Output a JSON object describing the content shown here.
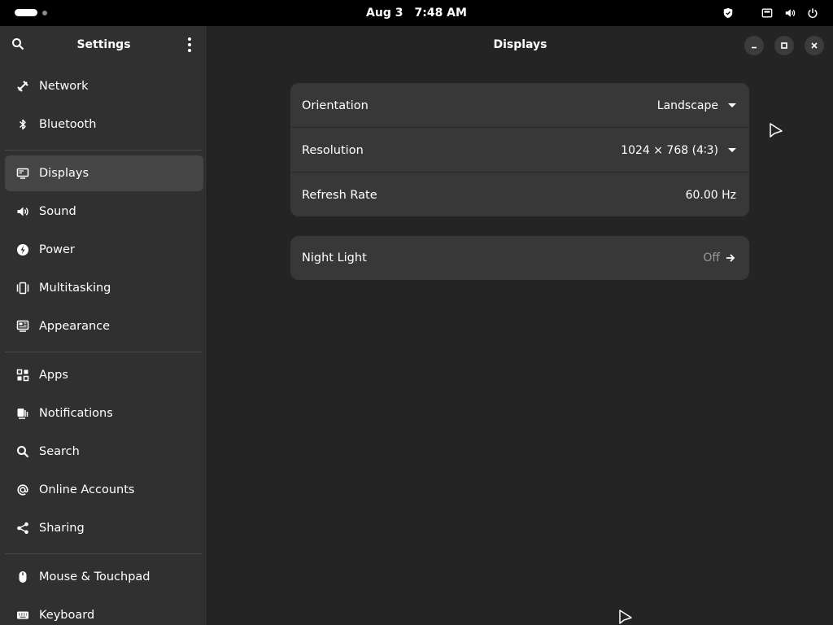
{
  "topbar": {
    "date": "Aug 3",
    "time": "7:48 AM",
    "tray_icons": [
      "shield-icon",
      "network-wired-icon",
      "volume-icon",
      "power-icon"
    ]
  },
  "sidebar": {
    "title": "Settings",
    "search_icon": "search-icon",
    "menu_icon": "kebab-menu-icon",
    "items": [
      {
        "label": "Network",
        "icon": "network-icon"
      },
      {
        "label": "Bluetooth",
        "icon": "bluetooth-icon"
      },
      {
        "label": "Displays",
        "icon": "display-icon",
        "active": true
      },
      {
        "label": "Sound",
        "icon": "speaker-icon"
      },
      {
        "label": "Power",
        "icon": "power-bolt-icon"
      },
      {
        "label": "Multitasking",
        "icon": "multitasking-icon"
      },
      {
        "label": "Appearance",
        "icon": "appearance-icon"
      },
      {
        "label": "Apps",
        "icon": "apps-grid-icon"
      },
      {
        "label": "Notifications",
        "icon": "notifications-icon"
      },
      {
        "label": "Search",
        "icon": "search-icon"
      },
      {
        "label": "Online Accounts",
        "icon": "at-icon"
      },
      {
        "label": "Sharing",
        "icon": "share-icon"
      },
      {
        "label": "Mouse & Touchpad",
        "icon": "mouse-icon"
      },
      {
        "label": "Keyboard",
        "icon": "keyboard-icon"
      }
    ]
  },
  "content": {
    "title": "Displays",
    "window_buttons": [
      "minimize-icon",
      "maximize-icon",
      "close-icon"
    ],
    "display_settings": [
      {
        "label": "Orientation",
        "value": "Landscape",
        "control": "dropdown"
      },
      {
        "label": "Resolution",
        "value": "1024 × 768 (4∶3)",
        "control": "dropdown"
      },
      {
        "label": "Refresh Rate",
        "value": "60.00 Hz",
        "control": "static"
      }
    ],
    "night_light": {
      "label": "Night Light",
      "value": "Off",
      "icon": "arrow-right-icon"
    }
  },
  "colors": {
    "topbar_bg": "#000000",
    "sidebar_bg": "#303030",
    "content_bg": "#242424",
    "card_bg": "#383838",
    "active_item_bg": "#454545",
    "text": "#ffffff",
    "dim_text": "#9a9a9a"
  }
}
